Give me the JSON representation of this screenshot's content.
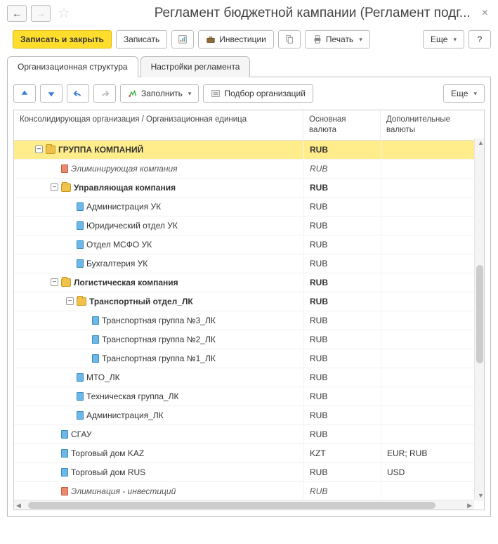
{
  "header": {
    "title": "Регламент бюджетной кампании (Регламент подг...",
    "back": "←",
    "forward": "→",
    "star": "☆",
    "close": "×"
  },
  "toolbar": {
    "save_close": "Записать и закрыть",
    "save": "Записать",
    "investments": "Инвестиции",
    "print": "Печать",
    "more": "Еще",
    "help": "?"
  },
  "tabs": {
    "org": "Организационная структура",
    "settings": "Настройки регламента"
  },
  "subtoolbar": {
    "fill": "Заполнить",
    "pick": "Подбор организаций",
    "more": "Еще"
  },
  "columns": {
    "c1": "Консолидирующая организация / Организационная единица",
    "c2": "Основная валюта",
    "c3": "Дополнительные валюты"
  },
  "rows": [
    {
      "indent": 1,
      "expander": "−",
      "icon": "folder",
      "name": "ГРУППА КОМПАНИЙ",
      "cur": "RUB",
      "extra": "",
      "style": "bold highlight"
    },
    {
      "indent": 2,
      "expander": "",
      "icon": "red",
      "name": "Элиминирующая компания",
      "cur": "RUB",
      "extra": "",
      "style": "italic"
    },
    {
      "indent": 2,
      "expander": "−",
      "icon": "folder",
      "name": "Управляющая компания",
      "cur": "RUB",
      "extra": "",
      "style": "bold"
    },
    {
      "indent": 3,
      "expander": "",
      "icon": "blue",
      "name": "Администрация УК",
      "cur": "RUB",
      "extra": "",
      "style": ""
    },
    {
      "indent": 3,
      "expander": "",
      "icon": "blue",
      "name": "Юридический отдел УК",
      "cur": "RUB",
      "extra": "",
      "style": ""
    },
    {
      "indent": 3,
      "expander": "",
      "icon": "blue",
      "name": "Отдел МСФО УК",
      "cur": "RUB",
      "extra": "",
      "style": ""
    },
    {
      "indent": 3,
      "expander": "",
      "icon": "blue",
      "name": "Бухгалтерия УК",
      "cur": "RUB",
      "extra": "",
      "style": ""
    },
    {
      "indent": 2,
      "expander": "−",
      "icon": "folder",
      "name": "Логистическая компания",
      "cur": "RUB",
      "extra": "",
      "style": "bold"
    },
    {
      "indent": 3,
      "expander": "−",
      "icon": "folder",
      "name": "Транспортный отдел_ЛК",
      "cur": "RUB",
      "extra": "",
      "style": "bold"
    },
    {
      "indent": 4,
      "expander": "",
      "icon": "blue",
      "name": "Транспортная группа №3_ЛК",
      "cur": "RUB",
      "extra": "",
      "style": ""
    },
    {
      "indent": 4,
      "expander": "",
      "icon": "blue",
      "name": "Транспортная группа №2_ЛК",
      "cur": "RUB",
      "extra": "",
      "style": ""
    },
    {
      "indent": 4,
      "expander": "",
      "icon": "blue",
      "name": "Транспортная группа №1_ЛК",
      "cur": "RUB",
      "extra": "",
      "style": ""
    },
    {
      "indent": 3,
      "expander": "",
      "icon": "blue",
      "name": "МТО_ЛК",
      "cur": "RUB",
      "extra": "",
      "style": ""
    },
    {
      "indent": 3,
      "expander": "",
      "icon": "blue",
      "name": "Техническая группа_ЛК",
      "cur": "RUB",
      "extra": "",
      "style": ""
    },
    {
      "indent": 3,
      "expander": "",
      "icon": "blue",
      "name": "Администрация_ЛК",
      "cur": "RUB",
      "extra": "",
      "style": ""
    },
    {
      "indent": 2,
      "expander": "",
      "icon": "blue",
      "name": "СГАУ",
      "cur": "RUB",
      "extra": "",
      "style": ""
    },
    {
      "indent": 2,
      "expander": "",
      "icon": "blue",
      "name": "Торговый дом KAZ",
      "cur": "KZT",
      "extra": "EUR; RUB",
      "style": ""
    },
    {
      "indent": 2,
      "expander": "",
      "icon": "blue",
      "name": "Торговый дом RUS",
      "cur": "RUB",
      "extra": "USD",
      "style": ""
    },
    {
      "indent": 2,
      "expander": "",
      "icon": "red",
      "name": "Элиминация - инвестиций",
      "cur": "RUB",
      "extra": "",
      "style": "italic"
    }
  ]
}
